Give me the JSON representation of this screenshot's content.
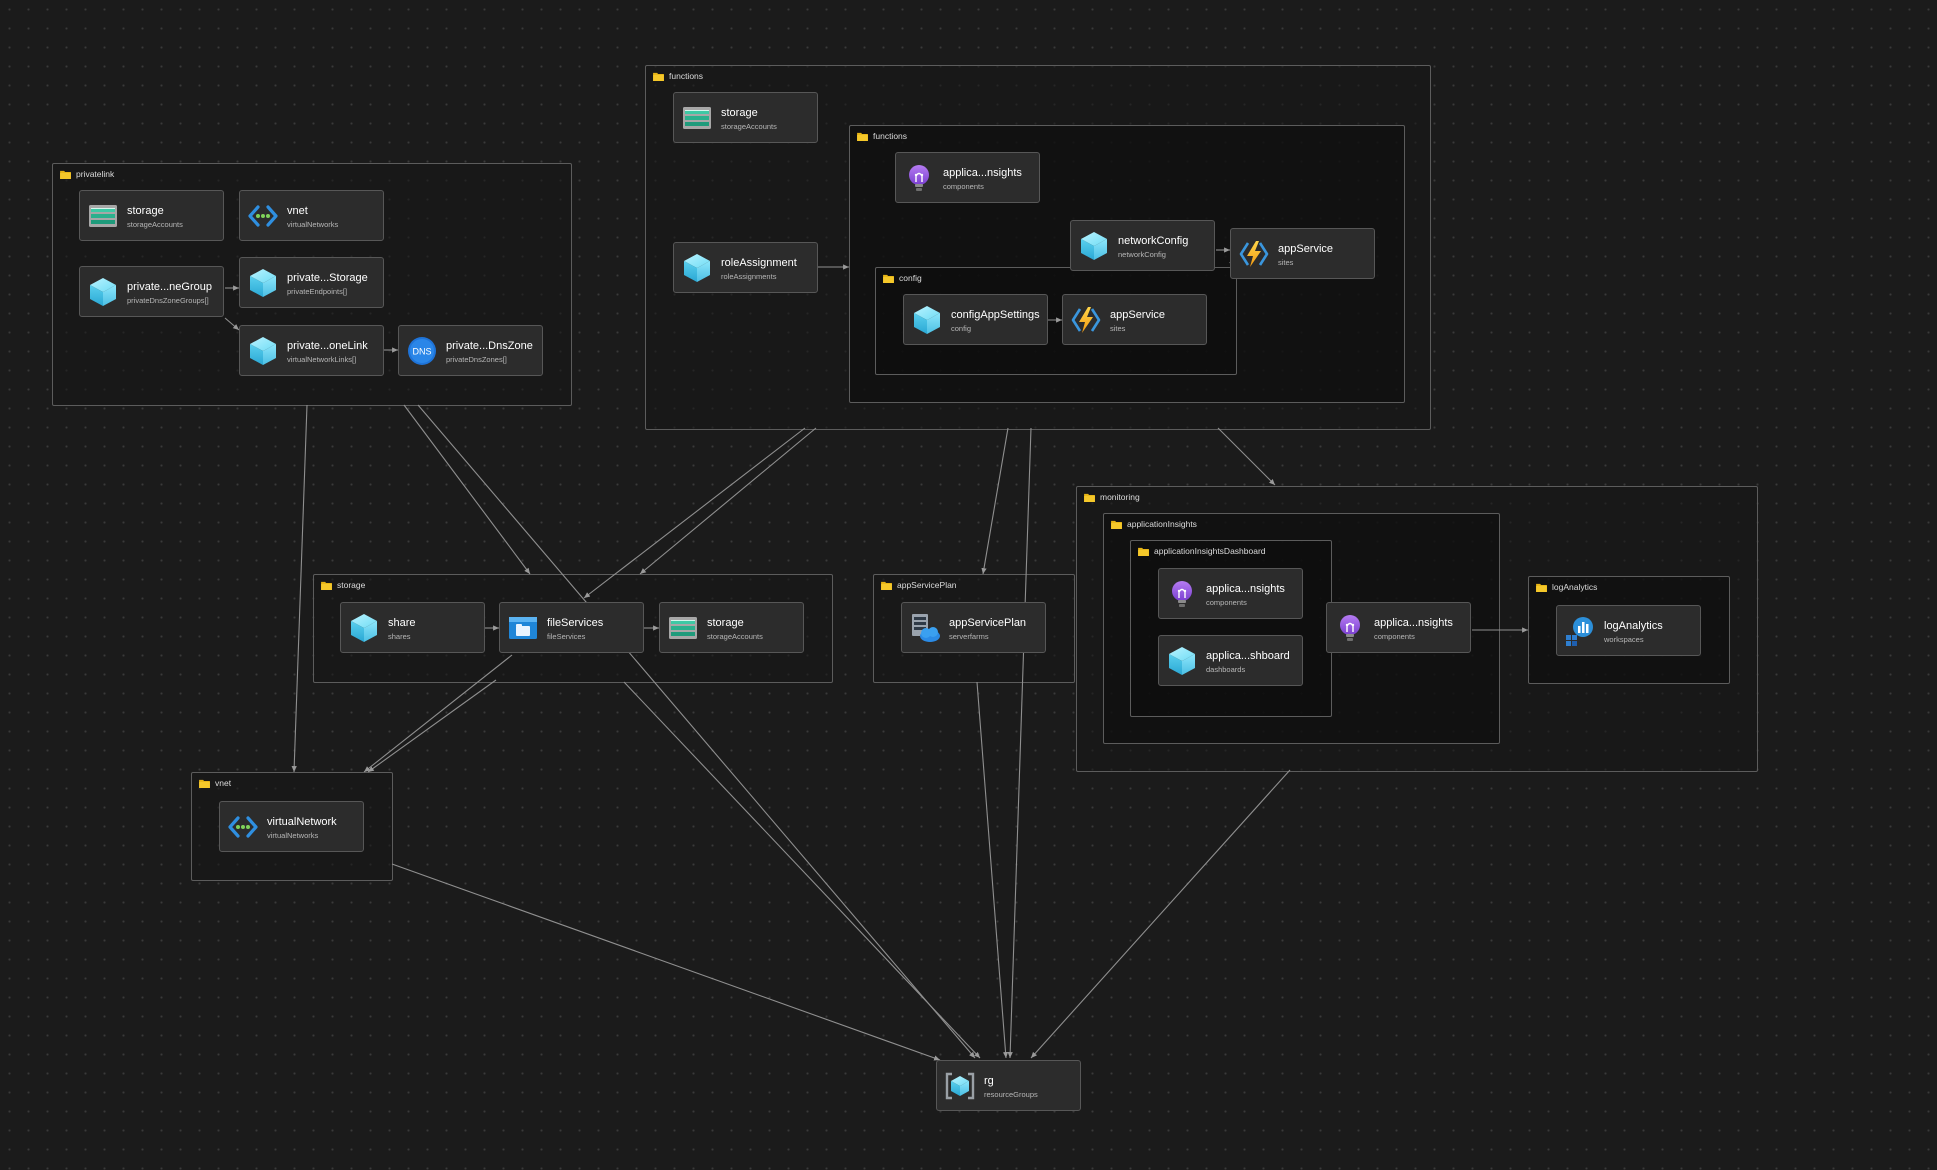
{
  "groups": {
    "privatelink": "privatelink",
    "functions_outer": "functions",
    "functions_inner": "functions",
    "config": "config",
    "storage": "storage",
    "appServicePlan": "appServicePlan",
    "monitoring": "monitoring",
    "applicationInsights": "applicationInsights",
    "applicationInsightsDashboard": "applicationInsightsDashboard",
    "logAnalytics": "logAnalytics",
    "vnet": "vnet"
  },
  "nodes": {
    "pl_storage": {
      "title": "storage",
      "sub": "storageAccounts",
      "icon": "storage-account-icon"
    },
    "pl_vnet": {
      "title": "vnet",
      "sub": "virtualNetworks",
      "icon": "virtual-network-icon"
    },
    "pl_dnsgroup": {
      "title": "private...neGroup",
      "sub": "privateDnsZoneGroups[]",
      "icon": "resource-cube-icon"
    },
    "pl_endpoint": {
      "title": "private...Storage",
      "sub": "privateEndpoints[]",
      "icon": "resource-cube-icon"
    },
    "pl_vnetlink": {
      "title": "private...oneLink",
      "sub": "virtualNetworkLinks[]",
      "icon": "resource-cube-icon"
    },
    "pl_dnszone": {
      "title": "private...DnsZone",
      "sub": "privateDnsZones[]",
      "icon": "dns-zone-icon"
    },
    "fn_storage": {
      "title": "storage",
      "sub": "storageAccounts",
      "icon": "storage-account-icon"
    },
    "fn_role": {
      "title": "roleAssignment",
      "sub": "roleAssignments",
      "icon": "resource-cube-icon"
    },
    "fn_insights": {
      "title": "applica...nsights",
      "sub": "components",
      "icon": "app-insights-icon"
    },
    "fn_netcfg": {
      "title": "networkConfig",
      "sub": "networkConfig",
      "icon": "resource-cube-icon"
    },
    "fn_appservice": {
      "title": "appService",
      "sub": "sites",
      "icon": "function-app-icon"
    },
    "cfg_settings": {
      "title": "configAppSettings",
      "sub": "config",
      "icon": "resource-cube-icon"
    },
    "cfg_appservice": {
      "title": "appService",
      "sub": "sites",
      "icon": "function-app-icon"
    },
    "st_share": {
      "title": "share",
      "sub": "shares",
      "icon": "resource-cube-icon"
    },
    "st_fileservices": {
      "title": "fileServices",
      "sub": "fileServices",
      "icon": "file-services-icon"
    },
    "st_storage": {
      "title": "storage",
      "sub": "storageAccounts",
      "icon": "storage-account-icon"
    },
    "asp_plan": {
      "title": "appServicePlan",
      "sub": "serverfarms",
      "icon": "app-service-plan-icon"
    },
    "mon_dash_insights": {
      "title": "applica...nsights",
      "sub": "components",
      "icon": "app-insights-icon"
    },
    "mon_dashboard": {
      "title": "applica...shboard",
      "sub": "dashboards",
      "icon": "resource-cube-icon"
    },
    "mon_insights": {
      "title": "applica...nsights",
      "sub": "components",
      "icon": "app-insights-icon"
    },
    "mon_loganalytics": {
      "title": "logAnalytics",
      "sub": "workspaces",
      "icon": "log-analytics-icon"
    },
    "vn_network": {
      "title": "virtualNetwork",
      "sub": "virtualNetworks",
      "icon": "virtual-network-icon"
    },
    "rg": {
      "title": "rg",
      "sub": "resourceGroups",
      "icon": "resource-group-icon"
    }
  }
}
